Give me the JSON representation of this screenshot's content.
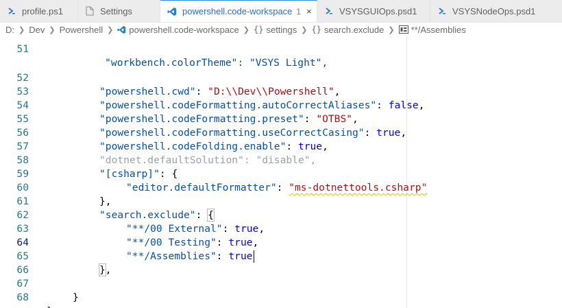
{
  "tabs": [
    {
      "label": "profile.ps1",
      "icon": "powershell-icon",
      "active": false,
      "dirty": ""
    },
    {
      "label": "Settings",
      "icon": "file-icon",
      "active": false,
      "dirty": ""
    },
    {
      "label": "powershell.code-workspace",
      "icon": "vscode-icon",
      "active": true,
      "dirty": "1"
    },
    {
      "label": "VSYSGUIOps.psd1",
      "icon": "powershell-icon",
      "active": false,
      "dirty": ""
    },
    {
      "label": "VSYSNodeOps.psd1",
      "icon": "powershell-icon",
      "active": false,
      "dirty": ""
    }
  ],
  "close_glyph": "×",
  "breadcrumb": {
    "drive": "D:",
    "dev": "Dev",
    "powershell": "Powershell",
    "workspace": "powershell.code-workspace",
    "settings": "settings",
    "search_exclude": "search.exclude",
    "assemblies": "**/Assemblies"
  },
  "editor": {
    "lines": [
      {
        "n": "51",
        "text": "    \"workbench.colorTheme\": \"VSYS Light\","
      },
      {
        "n": "52",
        "k": "\"powershell.cwd\"",
        "v": "\"D:\\\\Dev\\\\Powershell\""
      },
      {
        "n": "53",
        "k": "\"powershell.codeFormatting.autoCorrectAliases\"",
        "v": "false"
      },
      {
        "n": "54",
        "k": "\"powershell.codeFormatting.preset\"",
        "v": "\"OTBS\""
      },
      {
        "n": "55",
        "k": "\"powershell.codeFormatting.useCorrectCasing\"",
        "v": "true"
      },
      {
        "n": "56",
        "k": "\"powershell.codeFolding.enable\"",
        "v": "true"
      },
      {
        "n": "57",
        "k": "\"dotnet.defaultSolution\"",
        "v": "\"disable\""
      },
      {
        "n": "58",
        "k": "\"[csharp]\"",
        "v": "{"
      },
      {
        "n": "59",
        "k": "\"editor.defaultFormatter\"",
        "v": "\"ms-dotnettools.csharp\""
      },
      {
        "n": "60",
        "v": "},"
      },
      {
        "n": "61",
        "k": "\"search.exclude\"",
        "v": "{"
      },
      {
        "n": "62",
        "k": "\"**/00 External\"",
        "v": "true"
      },
      {
        "n": "63",
        "k": "\"**/00 Testing\"",
        "v": "true"
      },
      {
        "n": "64",
        "k": "\"**/Assemblies\"",
        "v": "true"
      },
      {
        "n": "65",
        "v": "}"
      },
      {
        "n": "66"
      },
      {
        "n": "67",
        "v": "}"
      },
      {
        "n": "68",
        "v": "}"
      }
    ],
    "colon": ": ",
    "comma": ","
  }
}
